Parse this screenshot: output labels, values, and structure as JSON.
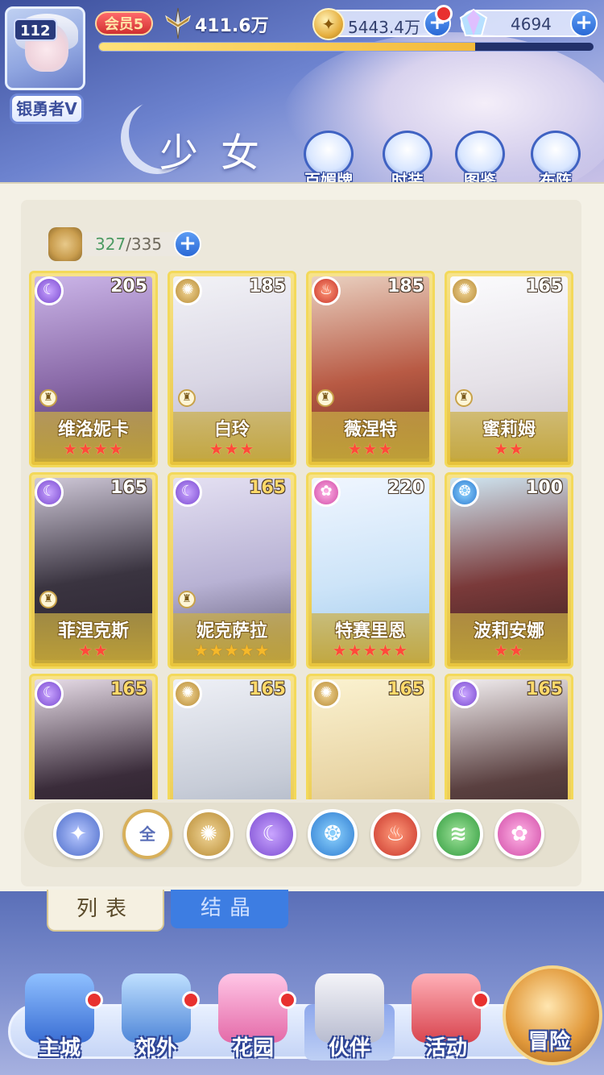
{
  "player": {
    "level": "112",
    "rank": "银勇者V",
    "vip": "会员5",
    "power": "411.6万",
    "exp_progress": 0.76
  },
  "resources": {
    "coin": "5443.4万",
    "gem": "4694"
  },
  "page": {
    "title": "少女"
  },
  "quick_buttons": [
    "百媚牌",
    "时装",
    "图鉴",
    "布阵"
  ],
  "collection": {
    "current": "327",
    "total": "/335"
  },
  "cards": [
    {
      "name": "维洛妮卡",
      "level": "205",
      "element": "moon",
      "stars": "★★★★"
    },
    {
      "name": "白玲",
      "level": "185",
      "element": "sun",
      "stars": "★★★"
    },
    {
      "name": "薇涅特",
      "level": "185",
      "element": "fire",
      "stars": "★★★"
    },
    {
      "name": "蜜莉姆",
      "level": "165",
      "element": "sun",
      "stars": "★★"
    },
    {
      "name": "菲涅克斯",
      "level": "165",
      "element": "moon",
      "stars": "★★"
    },
    {
      "name": "妮克萨拉",
      "level": "165",
      "element": "moon",
      "stars": "★★★★★"
    },
    {
      "name": "特赛里恩",
      "level": "220",
      "element": "pink",
      "stars": "★★★★★"
    },
    {
      "name": "波莉安娜",
      "level": "100",
      "element": "water",
      "stars": "★★"
    },
    {
      "name": "",
      "level": "165",
      "element": "moon",
      "stars": ""
    },
    {
      "name": "",
      "level": "165",
      "element": "sun",
      "stars": ""
    },
    {
      "name": "",
      "level": "165",
      "element": "sun",
      "stars": ""
    },
    {
      "name": "",
      "level": "165",
      "element": "moon",
      "stars": ""
    }
  ],
  "filters": {
    "all_label": "全",
    "items": [
      "star",
      "all",
      "sun",
      "moon",
      "water",
      "fire",
      "wind",
      "pink"
    ]
  },
  "tabs": {
    "list": "列表",
    "crystal": "结晶"
  },
  "nav": [
    "主城",
    "郊外",
    "花园",
    "伙伴",
    "活动",
    "冒险"
  ],
  "colors": {
    "accent": "#3d7de2",
    "notify": "#e8312f",
    "card_gold": "#e8c33c"
  }
}
